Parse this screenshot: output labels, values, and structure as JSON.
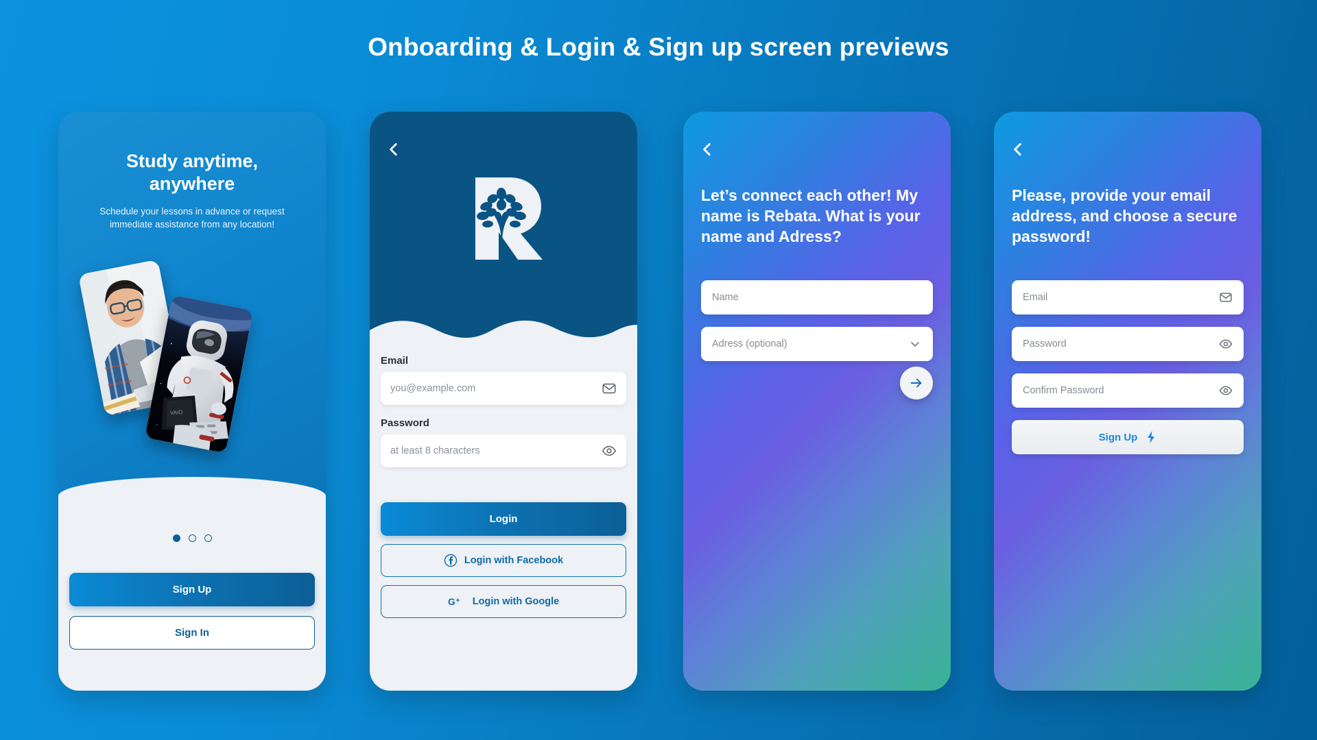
{
  "page": {
    "title": "Onboarding & Login & Sign up screen previews",
    "background_gradient_from": "#0b93e0",
    "background_gradient_to": "#045f9b"
  },
  "onboarding": {
    "title_line1": "Study anytime,",
    "title_line2": "anywhere",
    "subtitle": "Schedule your lessons in advance or request immediate assistance from any location!",
    "photos": [
      {
        "name": "student-photo",
        "alt": "Smiling student with glasses using a laptop"
      },
      {
        "name": "astronaut-photo",
        "alt": "Astronaut in spacesuit typing on a laptop in space"
      }
    ],
    "pager": {
      "total": 3,
      "active_index": 0
    },
    "primary_button": "Sign Up",
    "secondary_button": "Sign In",
    "accent_color": "#0f5f92"
  },
  "login": {
    "back_icon": "chevron-left-icon",
    "logo_letter": "R",
    "logo_icon": "tree-icon",
    "header_color": "#0a5484",
    "email": {
      "label": "Email",
      "placeholder": "you@example.com",
      "value": "",
      "icon": "envelope-icon"
    },
    "password": {
      "label": "Password",
      "placeholder": "at least 8 characters",
      "value": "",
      "icon": "eye-icon"
    },
    "login_button": "Login",
    "facebook_button": "Login with Facebook",
    "facebook_icon": "facebook-icon",
    "google_button": "Login with Google",
    "google_icon": "google-plus-icon",
    "accent_color": "#0e6ba8"
  },
  "connect": {
    "back_icon": "chevron-left-icon",
    "title": "Let’s connect each other! My name is Rebata. What is your name and Adress?",
    "name_field": {
      "placeholder": "Name",
      "value": ""
    },
    "address_field": {
      "placeholder": "Adress (optional)",
      "value": "",
      "icon": "chevron-down-icon"
    },
    "next_button_icon": "arrow-right-icon",
    "gradient_from": "#0e9ae0",
    "gradient_mid": "#6a5fe0",
    "gradient_to": "#38b394"
  },
  "signup": {
    "back_icon": "chevron-left-icon",
    "title": "Please, provide your email address, and choose a secure password!",
    "email_field": {
      "placeholder": "Email",
      "value": "",
      "icon": "envelope-icon"
    },
    "password_field": {
      "placeholder": "Password",
      "value": "",
      "icon": "eye-icon"
    },
    "confirm_field": {
      "placeholder": "Confirm Password",
      "value": "",
      "icon": "eye-icon"
    },
    "submit_button": "Sign Up",
    "submit_icon": "lightning-bolt-icon",
    "submit_color": "#1b86dd"
  }
}
